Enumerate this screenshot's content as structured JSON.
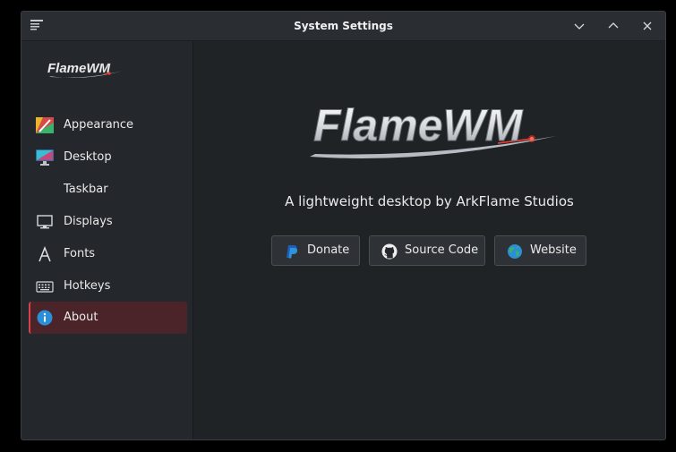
{
  "window": {
    "title": "System Settings",
    "controls": [
      "minimize",
      "maximize",
      "close"
    ]
  },
  "sidebar": {
    "logo_text": "FlameWM",
    "items": [
      {
        "label": "Appearance",
        "icon": "appearance-palette-icon"
      },
      {
        "label": "Desktop",
        "icon": "desktop-monitor-icon"
      },
      {
        "label": "Taskbar",
        "icon": ""
      },
      {
        "label": "Displays",
        "icon": "display-icon"
      },
      {
        "label": "Fonts",
        "icon": "font-icon"
      },
      {
        "label": "Hotkeys",
        "icon": "keyboard-icon"
      },
      {
        "label": "About",
        "icon": "info-icon",
        "active": true
      }
    ]
  },
  "about": {
    "logo_text": "FlameWM",
    "tagline": "A lightweight desktop by ArkFlame Studios",
    "buttons": [
      {
        "label": "Donate",
        "icon": "paypal-icon"
      },
      {
        "label": "Source Code",
        "icon": "github-icon"
      },
      {
        "label": "Website",
        "icon": "globe-icon"
      }
    ]
  },
  "colors": {
    "accent": "#d8404a",
    "active_item_bg": "#4a2428",
    "window_bg": "#202326",
    "sidebar_bg": "#24272b"
  }
}
